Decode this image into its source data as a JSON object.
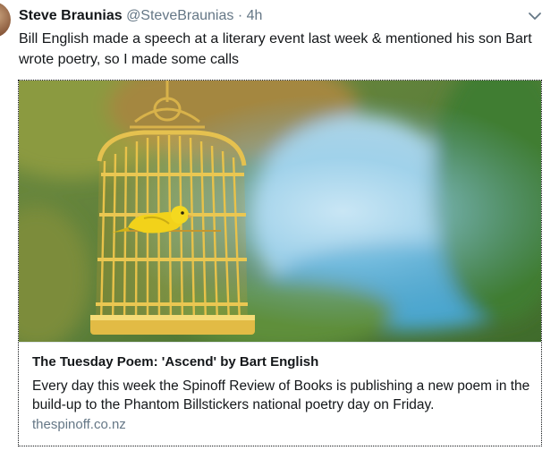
{
  "tweet": {
    "author_name": "Steve Braunias",
    "author_handle": "@SteveBraunias",
    "separator": "·",
    "timestamp": "4h",
    "text": "Bill English made a speech at a literary event last week & mentioned his son Bart wrote poetry, so I made some calls"
  },
  "card": {
    "image_subject": "yellow canary in a golden birdcage",
    "title": "The Tuesday Poem: 'Ascend' by Bart English",
    "description": "Every day this week the Spinoff Review of Books is publishing a new poem in the build-up to the Phantom Billstickers national poetry day on Friday.",
    "domain": "thespinoff.co.nz"
  },
  "icons": {
    "caret": "chevron-down-icon"
  },
  "colors": {
    "text": "#14171a",
    "muted": "#657786",
    "border": "#e1e8ed",
    "cage": "#e8c24a",
    "bird": "#f2d21a"
  }
}
